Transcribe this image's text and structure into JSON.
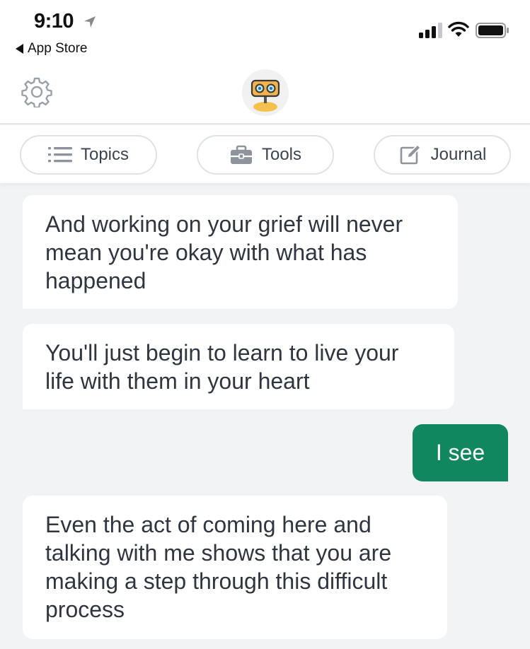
{
  "status_bar": {
    "time": "9:10",
    "back_app": "App Store",
    "icons": [
      "location-arrow-icon",
      "cellular-signal-icon",
      "wifi-icon",
      "battery-icon"
    ]
  },
  "header": {
    "settings_icon": "gear-icon",
    "avatar": "robot-avatar"
  },
  "tabs": [
    {
      "label": "Topics",
      "icon": "list-icon"
    },
    {
      "label": "Tools",
      "icon": "toolbox-icon"
    },
    {
      "label": "Journal",
      "icon": "edit-icon"
    }
  ],
  "messages": [
    {
      "from": "bot",
      "text": "And working on your grief will never mean you're okay with what has happened"
    },
    {
      "from": "bot",
      "text": "You'll just begin to learn to live your life with them in your heart"
    },
    {
      "from": "user",
      "text": "I see"
    },
    {
      "from": "bot",
      "text": "Even the act of coming here and talking with me shows that you are making a step through this difficult process"
    }
  ],
  "colors": {
    "user_bubble": "#11875f",
    "chat_background": "#f2f3f5",
    "bot_bubble": "#ffffff",
    "text": "#2f3640"
  }
}
